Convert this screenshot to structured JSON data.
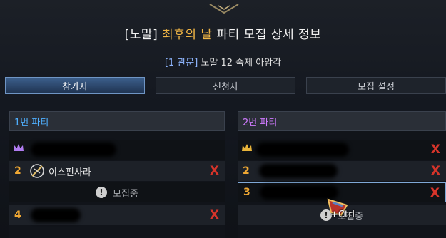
{
  "window": {
    "title_prefix": "[노말] ",
    "title_highlight": "최후의 날",
    "title_suffix": " 파티 모집 상세 정보"
  },
  "raid": {
    "tag": "[1 관문]",
    "name": " 노말 12 숙제 아암각"
  },
  "tabs": [
    {
      "label": "참가자",
      "active": true
    },
    {
      "label": "신청자",
      "active": false
    },
    {
      "label": "모집 설정",
      "active": false
    }
  ],
  "parties": [
    {
      "name": "1번 파티",
      "name_color": "#4fb0ff",
      "slots": [
        {
          "number": "",
          "player": "",
          "leader": true,
          "kick": ""
        },
        {
          "number": "2",
          "player": "이스핀사라",
          "kick": "X"
        },
        {
          "status": "모집중"
        },
        {
          "number": "4",
          "player": "",
          "kick": "X"
        }
      ]
    },
    {
      "name": "2번 파티",
      "name_color": "#d07bff",
      "slots": [
        {
          "number": "",
          "player": "",
          "leader": true,
          "kick": "X"
        },
        {
          "number": "2",
          "player": "",
          "kick": "X"
        },
        {
          "number": "3",
          "player": "",
          "kick": "X",
          "selected": true
        },
        {
          "status": "모집중"
        }
      ]
    }
  ],
  "cursor": {
    "hint": "+Ctrl"
  },
  "colors": {
    "accent": "#f0b545",
    "kick": "#d6342a",
    "slot_number": "#f0a833"
  }
}
